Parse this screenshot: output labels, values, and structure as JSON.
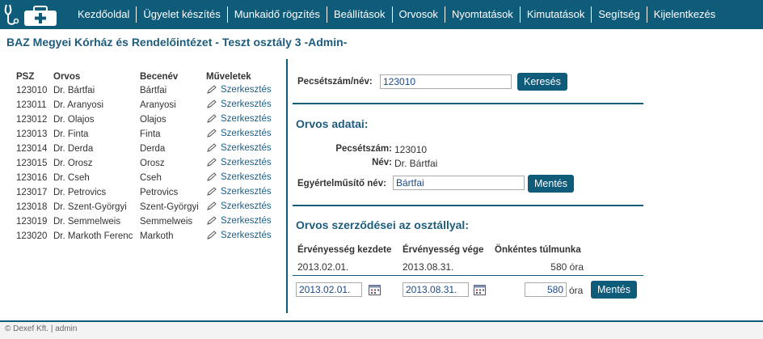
{
  "nav": {
    "items": [
      "Kezdőoldal",
      "Ügyelet készítés",
      "Munkaidő rögzítés",
      "Beállítások",
      "Orvosok",
      "Nyomtatások",
      "Kimutatások",
      "Segítség",
      "Kijelentkezés"
    ]
  },
  "page_title": "BAZ Megyei Kórház és Rendelőintézet - Teszt osztály 3 -Admin-",
  "doctors_table": {
    "headers": [
      "PSZ",
      "Orvos",
      "Becenév",
      "Műveletek"
    ],
    "edit_label": "Szerkesztés",
    "rows": [
      {
        "psz": "123010",
        "orvos": "Dr. Bártfai",
        "becenev": "Bártfai"
      },
      {
        "psz": "123011",
        "orvos": "Dr. Aranyosi",
        "becenev": "Aranyosi"
      },
      {
        "psz": "123012",
        "orvos": "Dr. Olajos",
        "becenev": "Olajos"
      },
      {
        "psz": "123013",
        "orvos": "Dr. Finta",
        "becenev": "Finta"
      },
      {
        "psz": "123014",
        "orvos": "Dr. Derda",
        "becenev": "Derda"
      },
      {
        "psz": "123015",
        "orvos": "Dr. Orosz",
        "becenev": "Orosz"
      },
      {
        "psz": "123016",
        "orvos": "Dr. Cseh",
        "becenev": "Cseh"
      },
      {
        "psz": "123017",
        "orvos": "Dr. Petrovics",
        "becenev": "Petrovics"
      },
      {
        "psz": "123018",
        "orvos": "Dr. Szent-Györgyi",
        "becenev": "Szent-Györgyi"
      },
      {
        "psz": "123019",
        "orvos": "Dr. Semmelweis",
        "becenev": "Semmelweis"
      },
      {
        "psz": "123020",
        "orvos": "Dr. Markoth Ferenc",
        "becenev": "Markoth"
      }
    ]
  },
  "search": {
    "label": "Pecsétszám/név:",
    "value": "123010",
    "button": "Keresés"
  },
  "doctor_data": {
    "title": "Orvos adatai:",
    "stamp_label": "Pecsétszám:",
    "stamp_value": "123010",
    "name_label": "Név:",
    "name_value": "Dr. Bártfai",
    "nick_label": "Egyértelműsítő név:",
    "nick_value": "Bártfai",
    "save_button": "Mentés"
  },
  "contracts": {
    "title": "Orvos szerződései az osztállyal:",
    "headers": [
      "Érvényesség kezdete",
      "Érvényesség vége",
      "Önkéntes túlmunka"
    ],
    "row": {
      "start": "2013.02.01.",
      "end": "2013.08.31.",
      "overtime": "580 óra"
    },
    "edit": {
      "start": "2013.02.01.",
      "end": "2013.08.31.",
      "overtime": "580",
      "unit": "óra",
      "save_button": "Mentés"
    }
  },
  "footer": "© Dexef Kft. | admin",
  "icons": {
    "logo": "stethoscope-medkit-logo",
    "edit": "pencil-icon",
    "calendar": "calendar-icon"
  },
  "colors": {
    "primary": "#0f5b7a",
    "title": "#1d5c7c",
    "link": "#1a5f8a"
  }
}
